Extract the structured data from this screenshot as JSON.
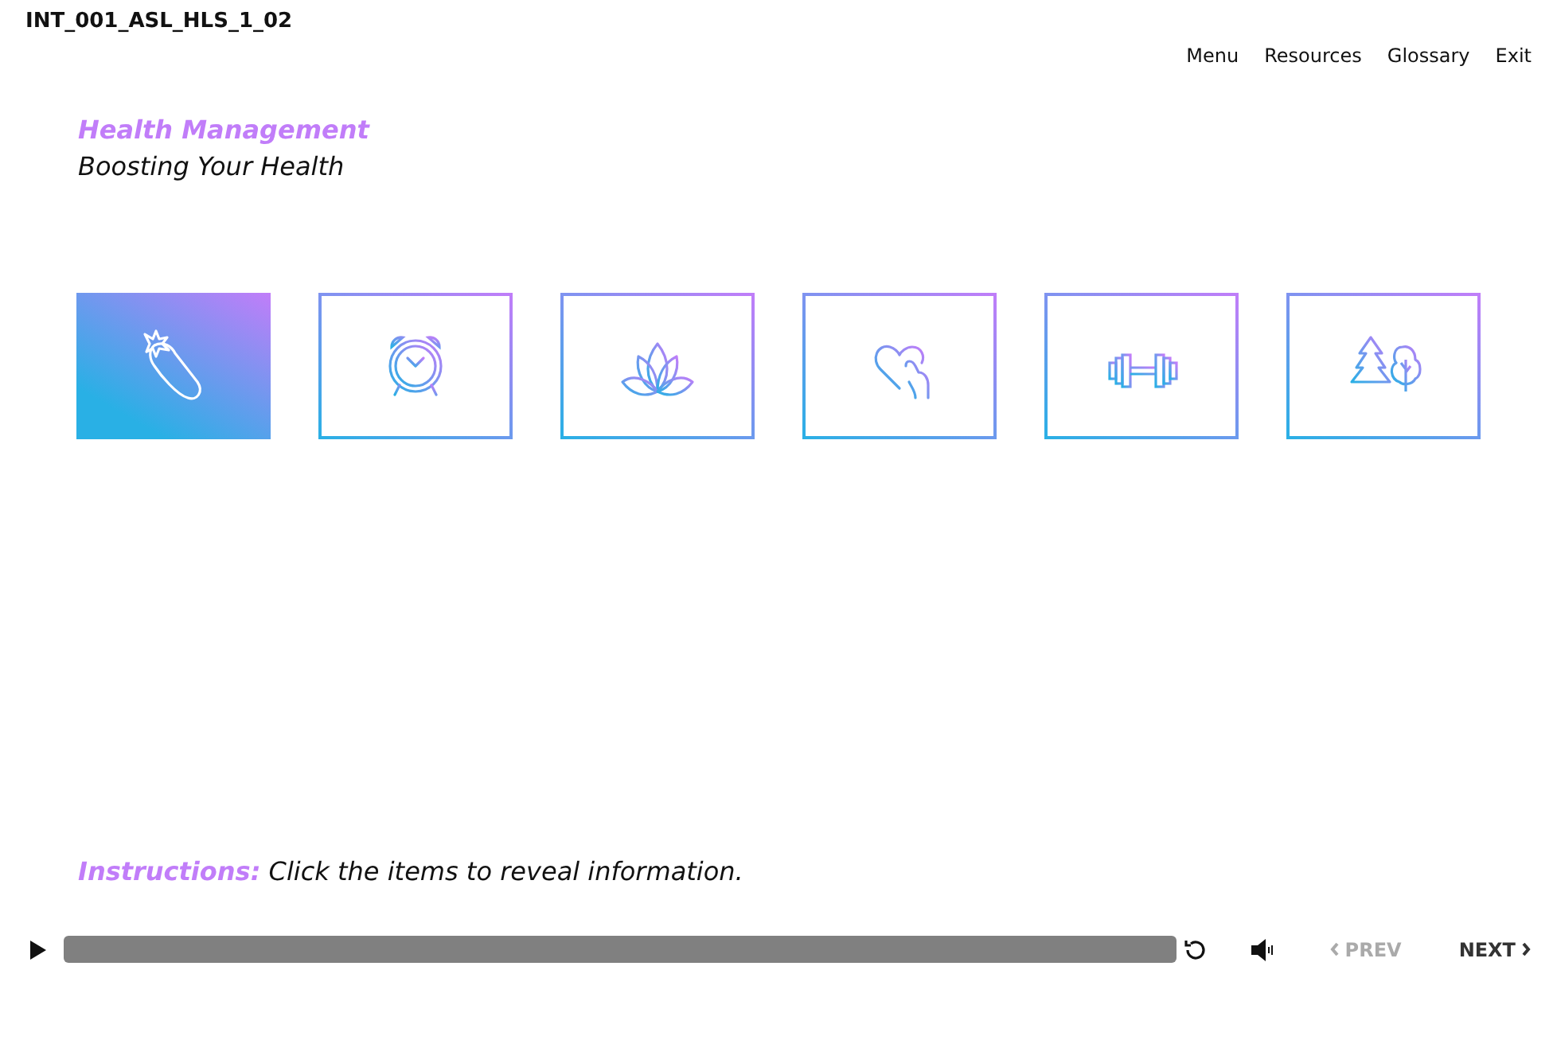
{
  "course_code": "INT_001_ASL_HLS_1_02",
  "nav": [
    "Menu",
    "Resources",
    "Glossary",
    "Exit"
  ],
  "heading": {
    "title": "Health Management",
    "subtitle": "Boosting Your Health"
  },
  "tiles": [
    {
      "kind": "eggplant",
      "selected": true
    },
    {
      "kind": "clock",
      "selected": false
    },
    {
      "kind": "lotus",
      "selected": false
    },
    {
      "kind": "heart",
      "selected": false
    },
    {
      "kind": "dumbbell",
      "selected": false
    },
    {
      "kind": "trees",
      "selected": false
    }
  ],
  "instructions": "**Instructions:** Click the items to reveal information.",
  "player": {
    "prev": {
      "label": "PREV",
      "disabled": true
    },
    "next": {
      "label": "NEXT",
      "disabled": false
    }
  }
}
